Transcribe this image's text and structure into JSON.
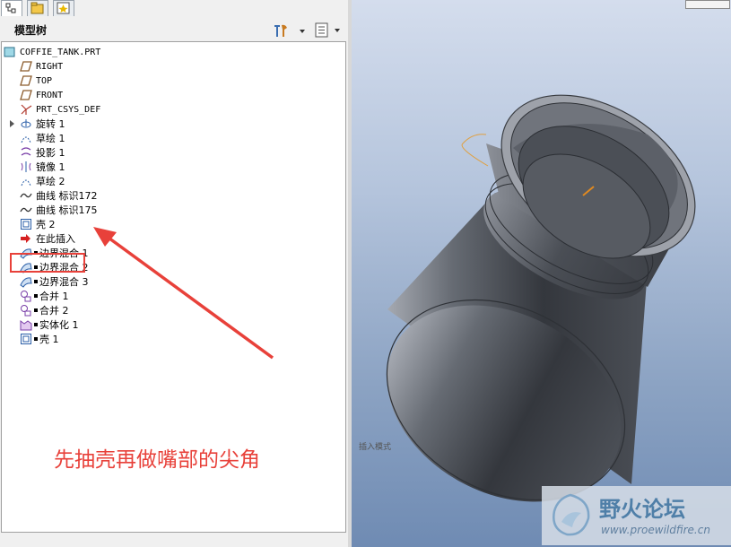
{
  "model_tree": {
    "title": "模型树",
    "root": "COFFIE_TANK.PRT",
    "items": [
      {
        "label": "RIGHT",
        "icon": "datum-plane-icon",
        "mono": true
      },
      {
        "label": "TOP",
        "icon": "datum-plane-icon",
        "mono": true
      },
      {
        "label": "FRONT",
        "icon": "datum-plane-icon",
        "mono": true
      },
      {
        "label": "PRT_CSYS_DEF",
        "icon": "csys-icon",
        "mono": true
      },
      {
        "label": "旋转 1",
        "icon": "revolve-icon",
        "expandable": true
      },
      {
        "label": "草绘 1",
        "icon": "sketch-icon"
      },
      {
        "label": "投影 1",
        "icon": "projection-icon"
      },
      {
        "label": "镜像 1",
        "icon": "mirror-icon"
      },
      {
        "label": "草绘 2",
        "icon": "sketch-icon"
      },
      {
        "label": "曲线 标识172",
        "icon": "curve-icon"
      },
      {
        "label": "曲线 标识175",
        "icon": "curve-icon"
      },
      {
        "label": "壳 2",
        "icon": "shell-icon"
      },
      {
        "label": "在此插入",
        "icon": "insert-here-arrow-icon"
      },
      {
        "label": "边界混合 1",
        "icon": "boundary-blend-icon",
        "flag": true
      },
      {
        "label": "边界混合 2",
        "icon": "boundary-blend-icon",
        "flag": true
      },
      {
        "label": "边界混合 3",
        "icon": "boundary-blend-icon",
        "flag": true
      },
      {
        "label": "合并 1",
        "icon": "merge-icon",
        "flag": true
      },
      {
        "label": "合并 2",
        "icon": "merge-icon",
        "flag": true
      },
      {
        "label": "实体化 1",
        "icon": "solidify-icon",
        "flag": true
      },
      {
        "label": "壳 1",
        "icon": "shell-icon",
        "flag": true
      }
    ]
  },
  "annotation": {
    "text": "先抽壳再做嘴部的尖角",
    "color": "#e8413a"
  },
  "viewport": {
    "status_hint": "插入模式"
  },
  "watermark": {
    "title": "野火论坛",
    "url": "www.proewildfire.cn"
  },
  "colors": {
    "accent_red": "#e8413a",
    "model_gray": "#5a5e66",
    "background_top": "#d4dded",
    "background_bottom": "#6f8bb3"
  }
}
